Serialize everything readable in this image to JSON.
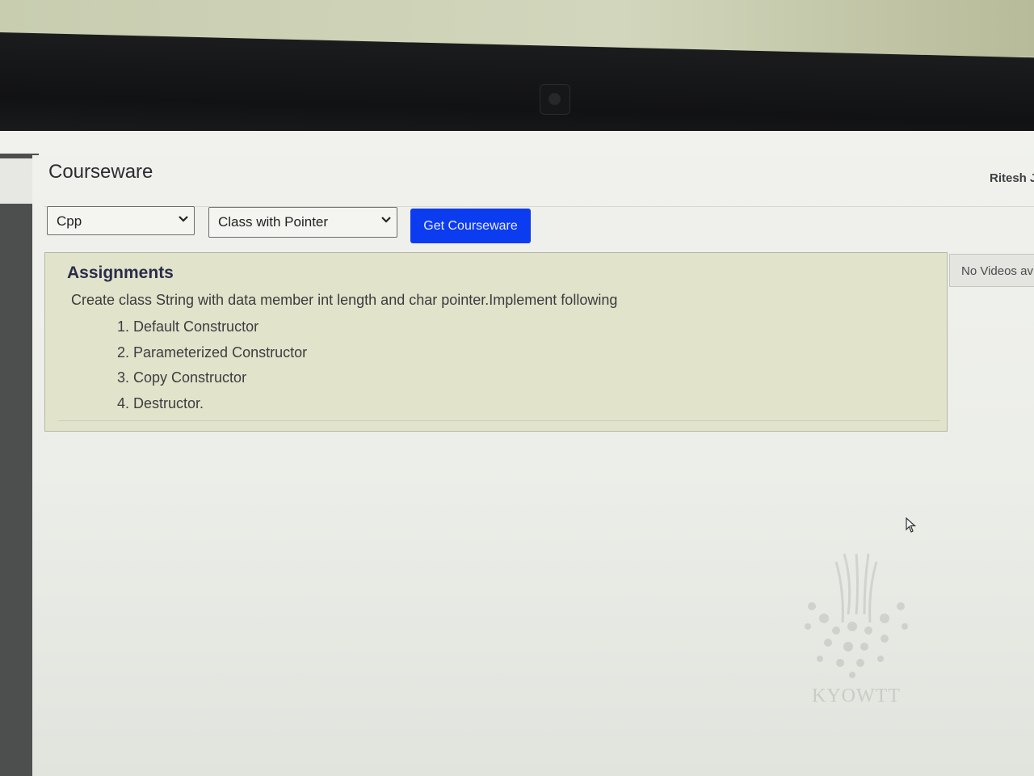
{
  "header": {
    "title": "Courseware",
    "user_name": "Ritesh J"
  },
  "filters": {
    "language_selected": "Cpp",
    "topic_selected": "Class with Pointer",
    "submit_label": "Get Courseware"
  },
  "assignments": {
    "heading": "Assignments",
    "description": "Create class String with data member int length and char pointer.Implement following",
    "items": [
      "1. Default Constructor",
      "2. Parameterized Constructor",
      "3. Copy Constructor",
      "4. Destructor."
    ]
  },
  "videos": {
    "empty_text": "No Videos av"
  },
  "watermark": {
    "text": "KYOWTT"
  },
  "colors": {
    "button": "#0c3cf0",
    "panel": "#e2e3cb",
    "bezel": "#111213"
  },
  "icons": {
    "dropdown": "chevron-down-icon",
    "cursor": "mouse-cursor-icon",
    "webcam": "webcam-icon"
  }
}
